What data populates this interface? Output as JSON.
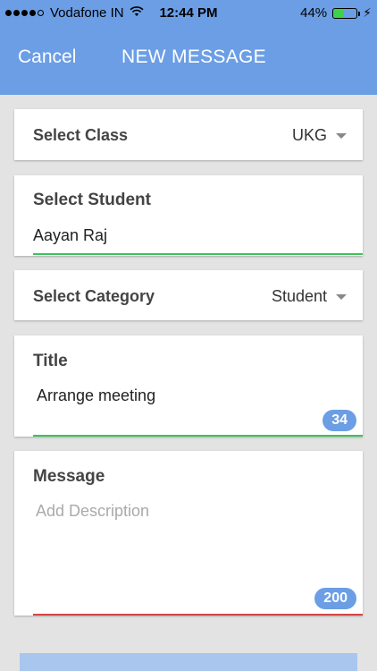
{
  "status_bar": {
    "carrier": "Vodafone IN",
    "time": "12:44 PM",
    "battery": "44%",
    "battery_level": 0.44,
    "battery_fill_color": "#3bd34b"
  },
  "nav": {
    "cancel_label": "Cancel",
    "title": "NEW MESSAGE",
    "background_color": "#6b9ee5"
  },
  "form": {
    "class": {
      "label": "Select Class",
      "value": "UKG"
    },
    "student": {
      "label": "Select Student",
      "value": "Aayan Raj",
      "underline_color": "#3cc35a"
    },
    "category": {
      "label": "Select Category",
      "value": "Student"
    },
    "title": {
      "label": "Title",
      "value": "Arrange meeting",
      "counter": "34",
      "underline_color": "#3cc35a"
    },
    "message": {
      "label": "Message",
      "placeholder": "Add Description",
      "counter": "200",
      "underline_color": "#d64545"
    }
  },
  "icons": {
    "dropdown": "chevron-down-icon",
    "wifi": "wifi-icon",
    "battery": "battery-icon",
    "charging": "bolt-icon"
  }
}
